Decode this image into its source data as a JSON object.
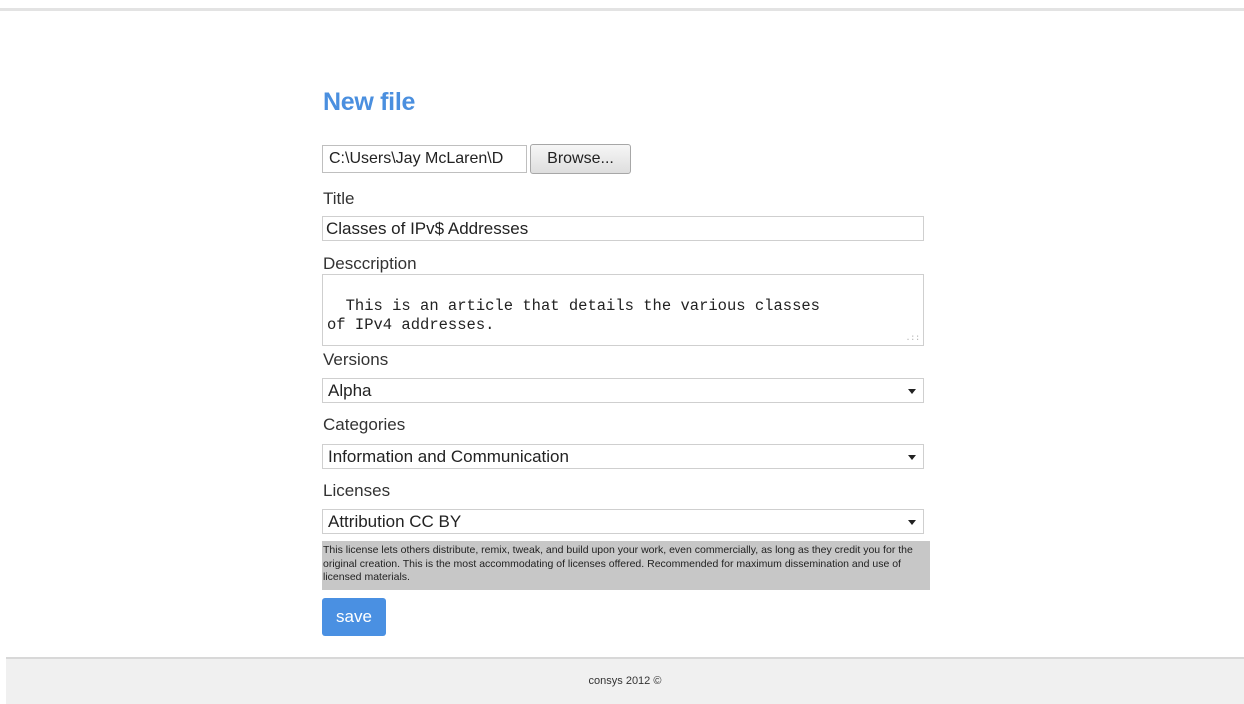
{
  "page": {
    "title": "New file"
  },
  "file": {
    "path": "C:\\Users\\Jay McLaren\\D",
    "browse_label": "Browse..."
  },
  "form": {
    "title_label": "Title",
    "title_value": "Classes of IPv$ Addresses",
    "description_label": "Desccription",
    "description_value": "This is an article that details the various classes\nof IPv4 addresses.",
    "versions_label": "Versions",
    "versions_value": "Alpha",
    "categories_label": "Categories",
    "categories_value": "Information and Communication",
    "licenses_label": "Licenses",
    "licenses_value": "Attribution CC BY",
    "license_description": "This license lets others distribute, remix, tweak, and build upon your work, even commercially, as long as they credit you for the original creation. This is the most accommodating of licenses offered. Recommended for maximum dissemination and use of licensed materials.",
    "save_label": "save"
  },
  "footer": {
    "text": "consys 2012 ©"
  },
  "colors": {
    "title": "#4a8fdf",
    "save_button": "#4a90e2",
    "license_box": "#c7c7c7",
    "footer_bg": "#f0f0f0"
  },
  "icons": {
    "select_arrow": "chevron-down-icon",
    "resize_grip": "resize-grip-icon"
  }
}
